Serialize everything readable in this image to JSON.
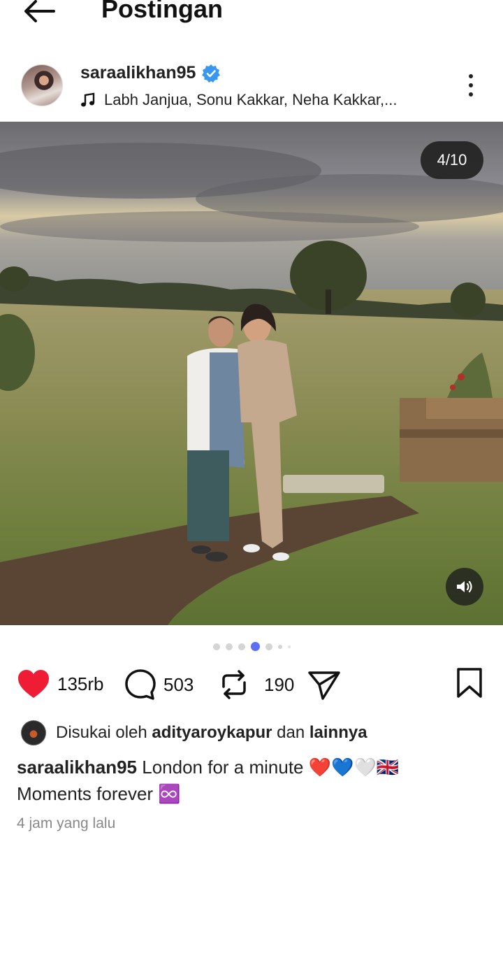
{
  "header": {
    "title": "Postingan"
  },
  "post": {
    "username": "saraalikhan95",
    "music": "Labh Janjua, Sonu Kakkar, Neha Kakkar,...",
    "slide_counter": "4/10"
  },
  "actions": {
    "likes": "135rb",
    "comments": "503",
    "reposts": "190"
  },
  "liked_by": {
    "prefix": "Disukai oleh",
    "user": "adityaroykapur",
    "conjunction": "dan",
    "others": "lainnya"
  },
  "caption": {
    "username": "saraalikhan95",
    "line1": "London for a minute ❤️💙🤍🇬🇧",
    "line2": "Moments forever ♾️"
  },
  "timestamp": "4 jam yang lalu",
  "colors": {
    "like": "#ee1d35",
    "verified": "#3897f0",
    "active_dot": "#5b6ef5"
  }
}
